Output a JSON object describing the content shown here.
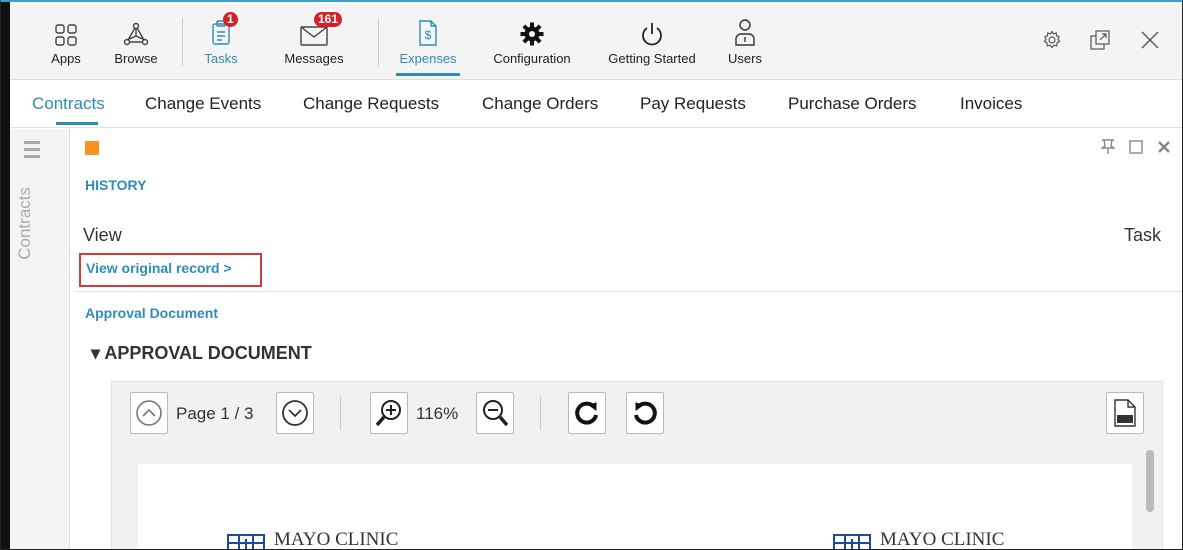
{
  "toolbar": {
    "apps": "Apps",
    "browse": "Browse",
    "tasks": "Tasks",
    "tasks_badge": "1",
    "messages": "Messages",
    "messages_badge": "161",
    "expenses": "Expenses",
    "configuration": "Configuration",
    "getting_started": "Getting Started",
    "users": "Users"
  },
  "subnav": {
    "tabs": [
      "Contracts",
      "Change Events",
      "Change Requests",
      "Change Orders",
      "Pay Requests",
      "Purchase Orders",
      "Invoices"
    ],
    "active": "Contracts"
  },
  "siderail": {
    "label": "Contracts"
  },
  "content": {
    "history": "HISTORY",
    "view": "View",
    "task": "Task",
    "view_original": "View original record >",
    "approval_link": "Approval Document",
    "approval_heading": "▾ APPROVAL DOCUMENT"
  },
  "viewer": {
    "page_label": "Page 1 / 3",
    "zoom": "116%"
  },
  "document": {
    "logo_left": "MAYO CLINIC",
    "logo_right": "MAYO CLINIC"
  },
  "colors": {
    "accent": "#2f8db5",
    "badge": "#d62027",
    "highlight": "#f7941d",
    "callout": "#d63b3b"
  }
}
